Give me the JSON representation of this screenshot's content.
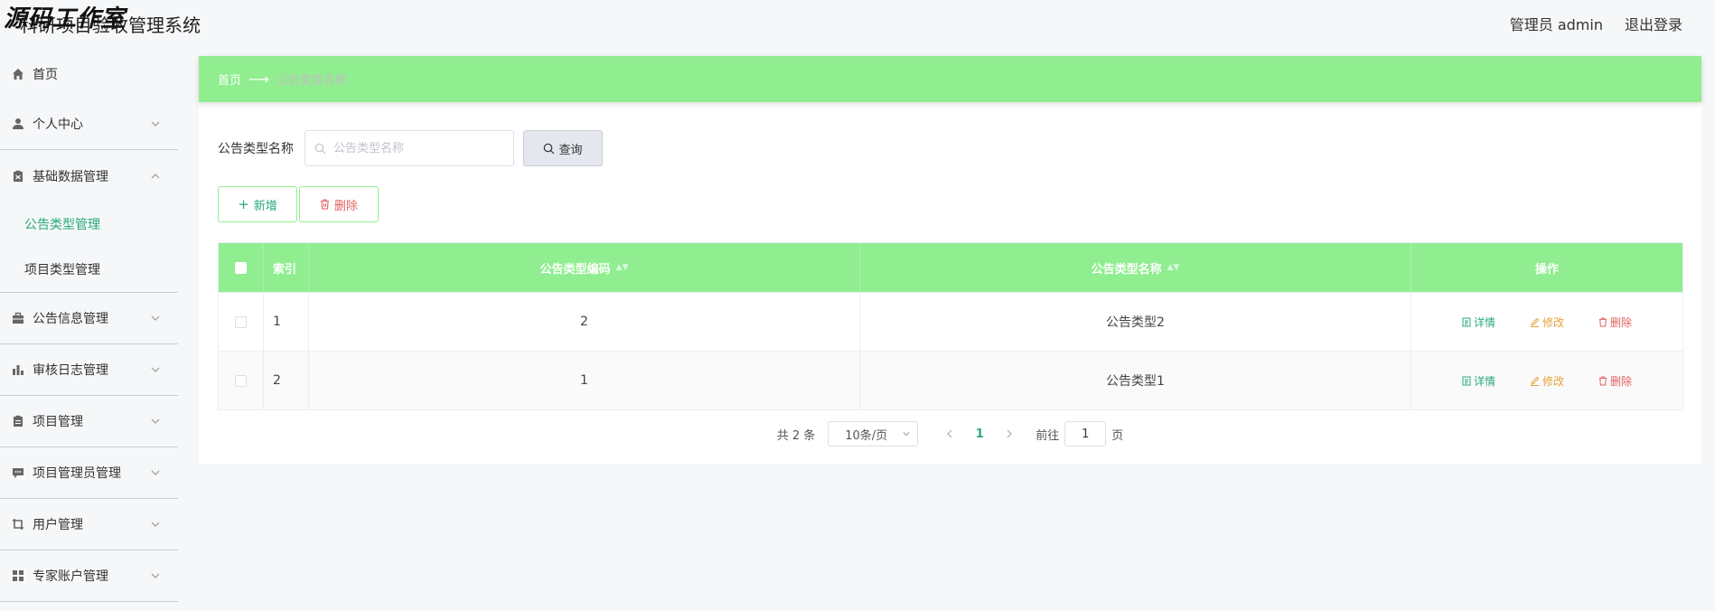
{
  "header": {
    "watermark": "源码工作室",
    "system_title": "科研项目验收管理系统",
    "user_label": "管理员 admin",
    "logout_label": "退出登录"
  },
  "sidebar": {
    "items": [
      {
        "label": "首页",
        "icon": "home-icon"
      },
      {
        "label": "个人中心",
        "icon": "user-icon"
      },
      {
        "label": "基础数据管理",
        "icon": "clipboard-icon",
        "expanded": true,
        "children": [
          {
            "label": "公告类型管理",
            "active": true
          },
          {
            "label": "项目类型管理"
          }
        ]
      },
      {
        "label": "公告信息管理",
        "icon": "briefcase-icon"
      },
      {
        "label": "审核日志管理",
        "icon": "bar-chart-icon"
      },
      {
        "label": "项目管理",
        "icon": "document-icon"
      },
      {
        "label": "项目管理员管理",
        "icon": "chat-icon"
      },
      {
        "label": "用户管理",
        "icon": "crop-icon"
      },
      {
        "label": "专家账户管理",
        "icon": "grid-icon"
      }
    ]
  },
  "breadcrumb": {
    "home": "首页",
    "current": "公告类型名称"
  },
  "search": {
    "label": "公告类型名称",
    "placeholder": "公告类型名称",
    "value": "",
    "button_label": "查询"
  },
  "actions": {
    "add_label": "新增",
    "delete_label": "删除"
  },
  "table": {
    "columns": [
      "索引",
      "公告类型编码",
      "公告类型名称",
      "操作"
    ],
    "rows": [
      {
        "index": "1",
        "code": "2",
        "name": "公告类型2"
      },
      {
        "index": "2",
        "code": "1",
        "name": "公告类型1"
      }
    ],
    "row_actions": {
      "detail": "详情",
      "edit": "修改",
      "delete": "删除"
    }
  },
  "pagination": {
    "total_text": "共 2 条",
    "page_size": "10条/页",
    "current_page": "1",
    "goto_label": "前往",
    "goto_value": "1",
    "page_suffix": "页"
  },
  "colors": {
    "accent": "#90ee90",
    "active_text": "#29a87b",
    "edit": "#e6a23c",
    "danger": "#e0625f"
  }
}
